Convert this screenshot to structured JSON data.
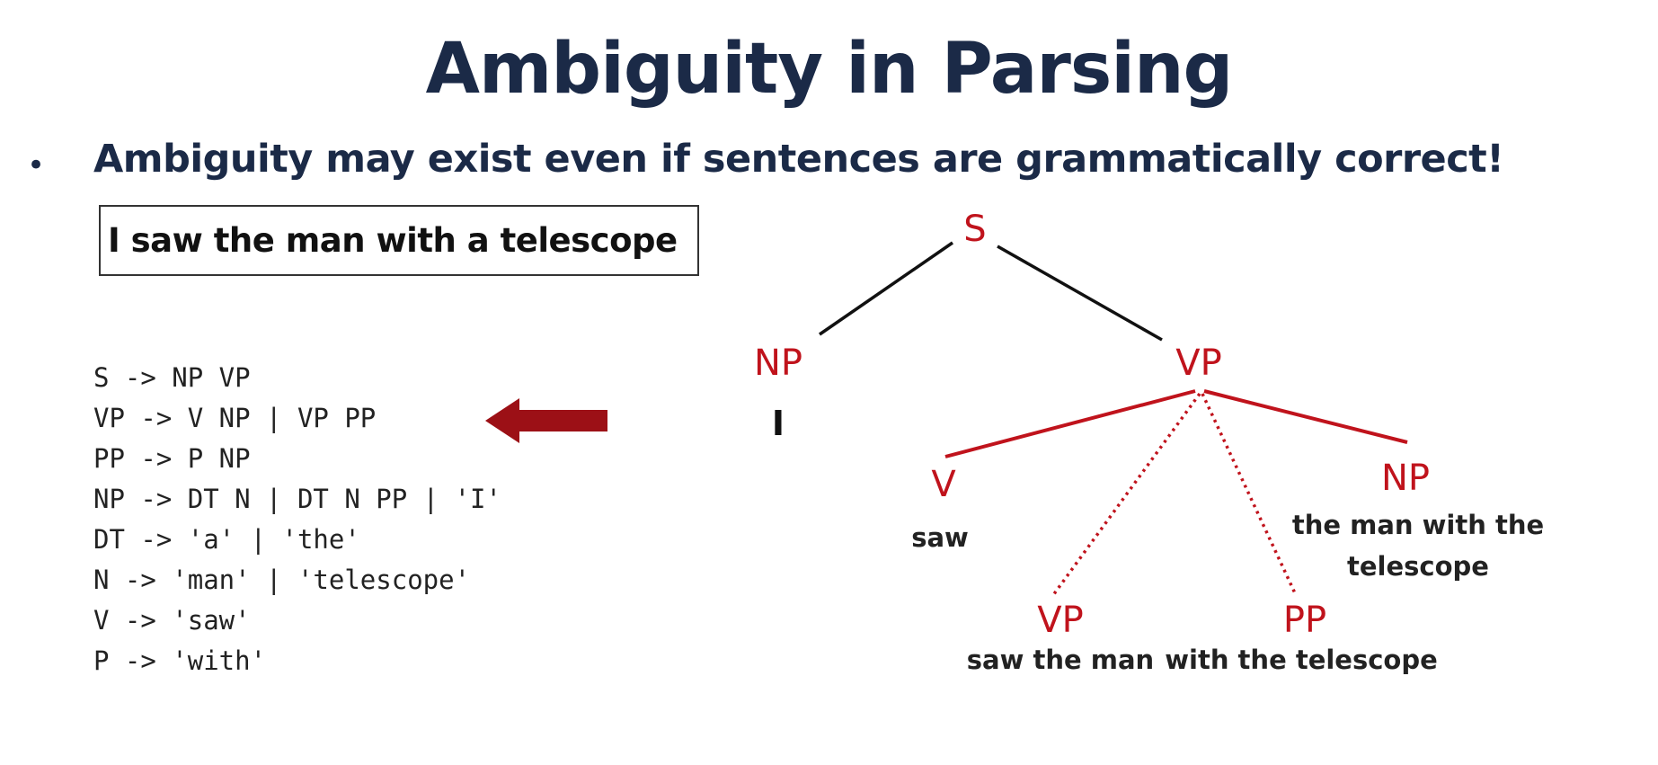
{
  "slide": {
    "title": "Ambiguity in Parsing",
    "bullet": "Ambiguity may exist even if sentences are grammatically correct!",
    "sentence": "I saw the man with a telescope",
    "grammar_rules": [
      "S -> NP VP",
      "VP -> V NP | VP PP",
      "PP -> P NP",
      "NP -> DT N | DT N PP | 'I'",
      "DT -> 'a' | 'the'",
      "N -> 'man' | 'telescope'",
      "V -> 'saw'",
      "P -> 'with'"
    ]
  },
  "tree": {
    "root": "S",
    "np_top": "NP",
    "np_top_leaf": "I",
    "vp_top": "VP",
    "v": "V",
    "v_leaf": "saw",
    "np_right": "NP",
    "np_right_leaf_line1": "the man with the",
    "np_right_leaf_line2": "telescope",
    "vp_low": "VP",
    "vp_low_leaf": "saw the man",
    "pp_low": "PP",
    "pp_low_leaf": "with the telescope"
  },
  "colors": {
    "title": "#1b2a47",
    "node_red": "#c0131c",
    "arrow_red": "#9c1016",
    "edge_black": "#111111"
  }
}
